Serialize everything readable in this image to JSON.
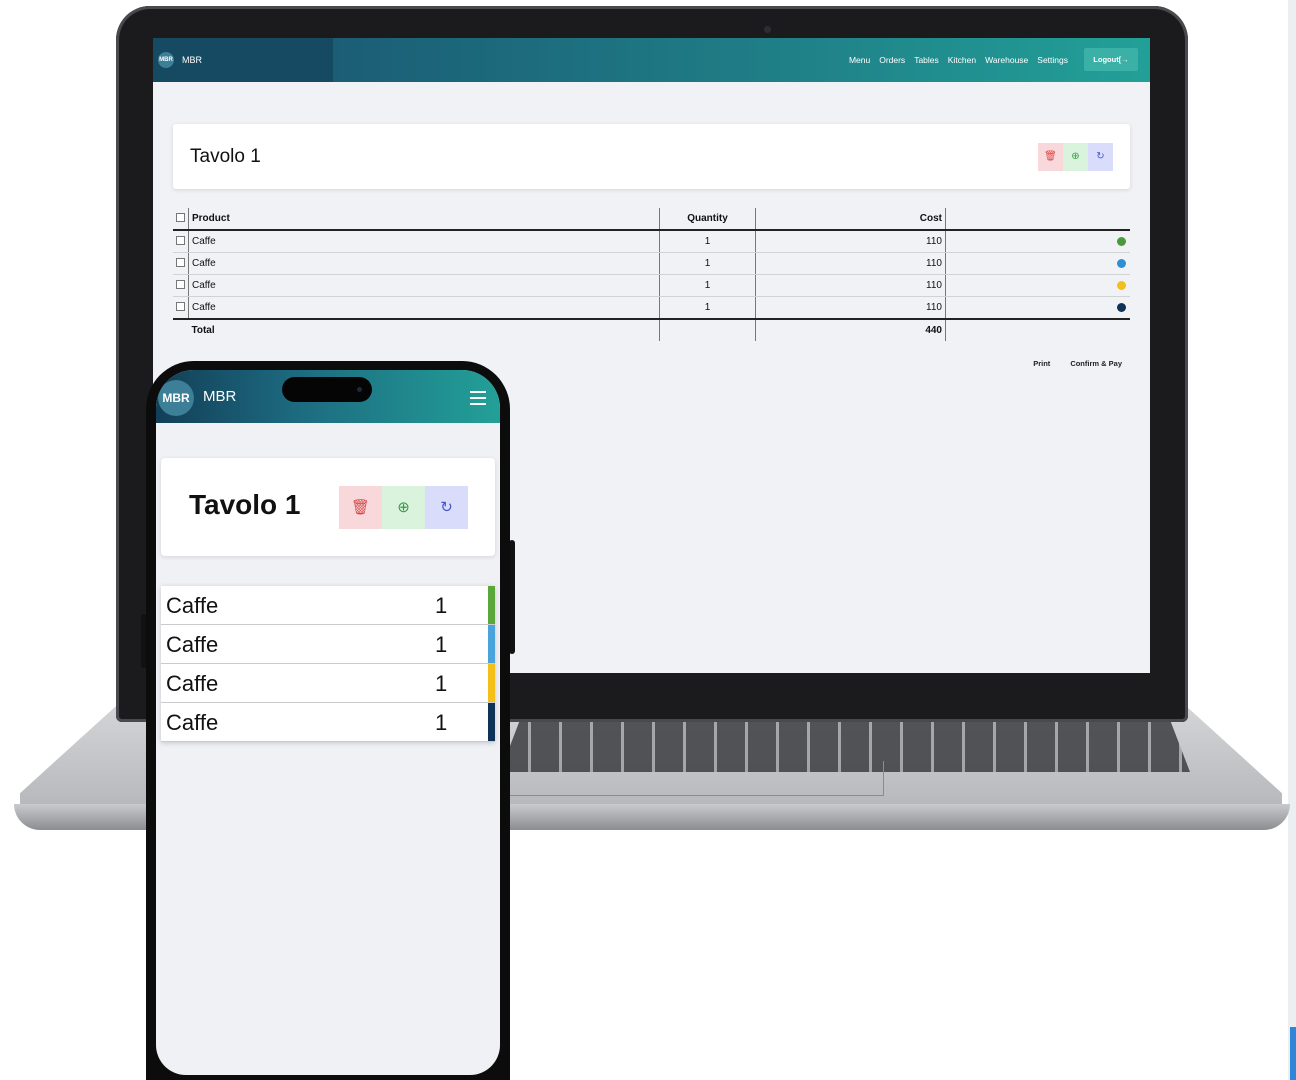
{
  "colors": {
    "green": "#4a9a3c",
    "blue": "#2f8fd4",
    "yellow": "#f3c019",
    "navy": "#0f3357"
  },
  "desktop": {
    "logo_badge": "MBR",
    "brand": "MBR",
    "nav": [
      "Menu",
      "Orders",
      "Tables",
      "Kitchen",
      "Warehouse",
      "Settings"
    ],
    "logout_label": "Logout",
    "table_title": "Tavolo 1",
    "headers": {
      "product": "Product",
      "quantity": "Quantity",
      "cost": "Cost"
    },
    "rows": [
      {
        "product": "Caffe",
        "quantity": "1",
        "cost": "110",
        "color": "#4a9a3c"
      },
      {
        "product": "Caffe",
        "quantity": "1",
        "cost": "110",
        "color": "#2f8fd4"
      },
      {
        "product": "Caffe",
        "quantity": "1",
        "cost": "110",
        "color": "#f3c019"
      },
      {
        "product": "Caffe",
        "quantity": "1",
        "cost": "110",
        "color": "#0f3357"
      }
    ],
    "total_label": "Total",
    "total_cost": "440",
    "print_label": "Print",
    "confirm_label": "Confirm & Pay"
  },
  "mobile": {
    "logo_badge": "MBR",
    "brand": "MBR",
    "table_title": "Tavolo 1",
    "items": [
      {
        "product": "Caffe",
        "quantity": "1",
        "color": "#5aa83c"
      },
      {
        "product": "Caffe",
        "quantity": "1",
        "color": "#4aa3db"
      },
      {
        "product": "Caffe",
        "quantity": "1",
        "color": "#f3c019"
      },
      {
        "product": "Caffe",
        "quantity": "1",
        "color": "#0f3357"
      }
    ]
  },
  "icons": {
    "delete": "trash-icon",
    "add": "plus-circle-icon",
    "refresh": "refresh-icon",
    "logout": "logout-icon",
    "menu": "hamburger-icon"
  }
}
